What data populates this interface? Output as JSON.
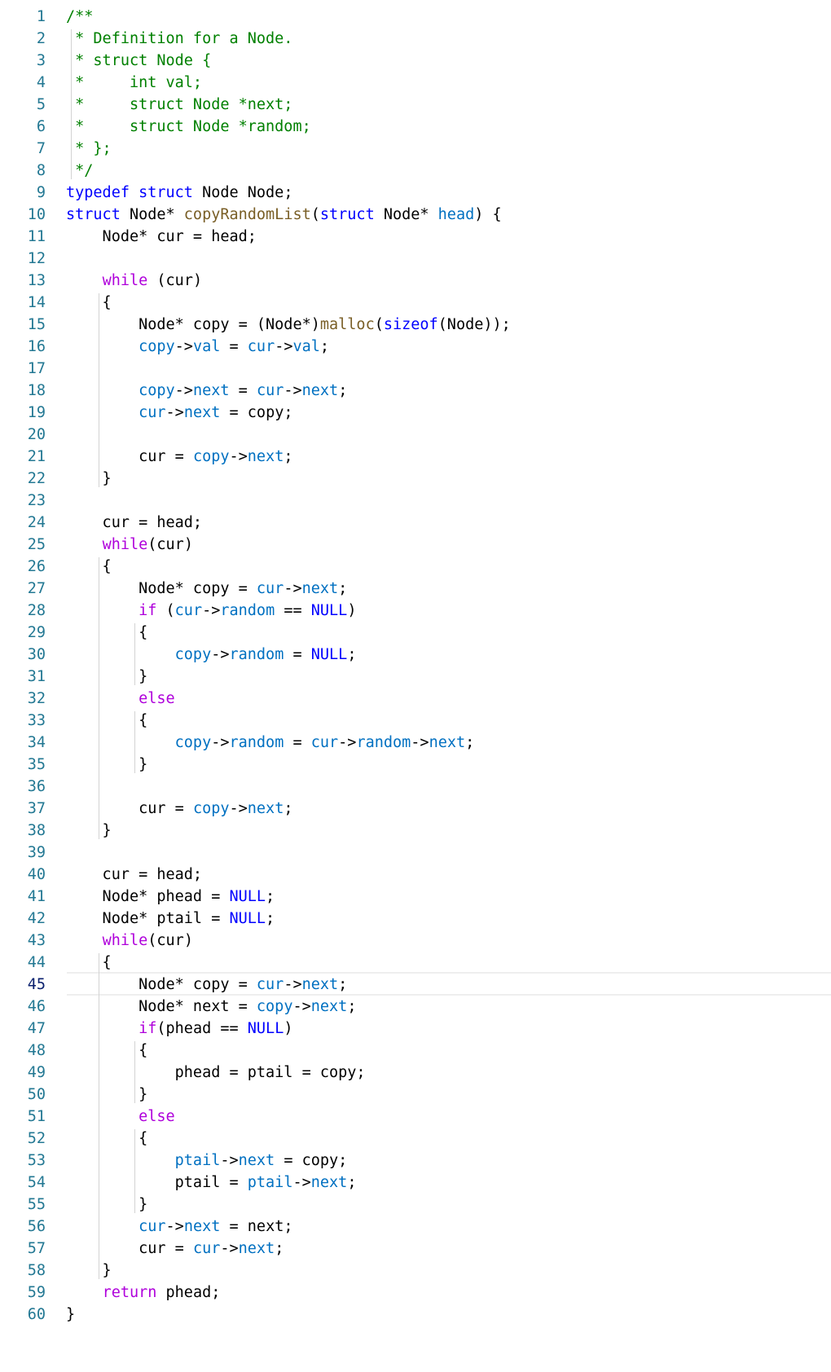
{
  "editor": {
    "language": "c",
    "active_line": 45,
    "colors": {
      "comment": "#008000",
      "keyword": "#0000ff",
      "function": "#795e26",
      "control": "#af00db",
      "member": "#0070c1",
      "default": "#000000",
      "line_number": "#237893"
    },
    "lines": [
      {
        "n": "1",
        "tokens": [
          [
            "c",
            "/**"
          ]
        ]
      },
      {
        "n": "2",
        "tokens": [
          [
            "c",
            " * Definition for a Node."
          ]
        ]
      },
      {
        "n": "3",
        "tokens": [
          [
            "c",
            " * struct Node {"
          ]
        ]
      },
      {
        "n": "4",
        "tokens": [
          [
            "c",
            " *     int val;"
          ]
        ]
      },
      {
        "n": "5",
        "tokens": [
          [
            "c",
            " *     struct Node *next;"
          ]
        ]
      },
      {
        "n": "6",
        "tokens": [
          [
            "c",
            " *     struct Node *random;"
          ]
        ]
      },
      {
        "n": "7",
        "tokens": [
          [
            "c",
            " * };"
          ]
        ]
      },
      {
        "n": "8",
        "tokens": [
          [
            "c",
            " */"
          ]
        ]
      },
      {
        "n": "9",
        "tokens": [
          [
            "k",
            "typedef"
          ],
          [
            "d",
            " "
          ],
          [
            "k",
            "struct"
          ],
          [
            "d",
            " Node Node;"
          ]
        ]
      },
      {
        "n": "10",
        "tokens": [
          [
            "k",
            "struct"
          ],
          [
            "d",
            " Node* "
          ],
          [
            "f",
            "copyRandomList"
          ],
          [
            "d",
            "("
          ],
          [
            "k",
            "struct"
          ],
          [
            "d",
            " Node* "
          ],
          [
            "v",
            "head"
          ],
          [
            "d",
            ") {"
          ]
        ]
      },
      {
        "n": "11",
        "tokens": [
          [
            "d",
            "    Node* cur = head;"
          ]
        ]
      },
      {
        "n": "12",
        "tokens": []
      },
      {
        "n": "13",
        "tokens": [
          [
            "d",
            "    "
          ],
          [
            "ctl",
            "while"
          ],
          [
            "d",
            " (cur)"
          ]
        ]
      },
      {
        "n": "14",
        "tokens": [
          [
            "d",
            "    {"
          ]
        ]
      },
      {
        "n": "15",
        "tokens": [
          [
            "d",
            "        Node* copy = (Node*)"
          ],
          [
            "f",
            "malloc"
          ],
          [
            "d",
            "("
          ],
          [
            "k",
            "sizeof"
          ],
          [
            "d",
            "(Node));"
          ]
        ]
      },
      {
        "n": "16",
        "tokens": [
          [
            "d",
            "        "
          ],
          [
            "v",
            "copy"
          ],
          [
            "d",
            "->"
          ],
          [
            "v",
            "val"
          ],
          [
            "d",
            " = "
          ],
          [
            "v",
            "cur"
          ],
          [
            "d",
            "->"
          ],
          [
            "v",
            "val"
          ],
          [
            "d",
            ";"
          ]
        ]
      },
      {
        "n": "17",
        "tokens": []
      },
      {
        "n": "18",
        "tokens": [
          [
            "d",
            "        "
          ],
          [
            "v",
            "copy"
          ],
          [
            "d",
            "->"
          ],
          [
            "v",
            "next"
          ],
          [
            "d",
            " = "
          ],
          [
            "v",
            "cur"
          ],
          [
            "d",
            "->"
          ],
          [
            "v",
            "next"
          ],
          [
            "d",
            ";"
          ]
        ]
      },
      {
        "n": "19",
        "tokens": [
          [
            "d",
            "        "
          ],
          [
            "v",
            "cur"
          ],
          [
            "d",
            "->"
          ],
          [
            "v",
            "next"
          ],
          [
            "d",
            " = copy;"
          ]
        ]
      },
      {
        "n": "20",
        "tokens": []
      },
      {
        "n": "21",
        "tokens": [
          [
            "d",
            "        cur = "
          ],
          [
            "v",
            "copy"
          ],
          [
            "d",
            "->"
          ],
          [
            "v",
            "next"
          ],
          [
            "d",
            ";"
          ]
        ]
      },
      {
        "n": "22",
        "tokens": [
          [
            "d",
            "    }"
          ]
        ]
      },
      {
        "n": "23",
        "tokens": []
      },
      {
        "n": "24",
        "tokens": [
          [
            "d",
            "    cur = head;"
          ]
        ]
      },
      {
        "n": "25",
        "tokens": [
          [
            "d",
            "    "
          ],
          [
            "ctl",
            "while"
          ],
          [
            "d",
            "(cur)"
          ]
        ]
      },
      {
        "n": "26",
        "tokens": [
          [
            "d",
            "    {"
          ]
        ]
      },
      {
        "n": "27",
        "tokens": [
          [
            "d",
            "        Node* copy = "
          ],
          [
            "v",
            "cur"
          ],
          [
            "d",
            "->"
          ],
          [
            "v",
            "next"
          ],
          [
            "d",
            ";"
          ]
        ]
      },
      {
        "n": "28",
        "tokens": [
          [
            "d",
            "        "
          ],
          [
            "ctl",
            "if"
          ],
          [
            "d",
            " ("
          ],
          [
            "v",
            "cur"
          ],
          [
            "d",
            "->"
          ],
          [
            "v",
            "random"
          ],
          [
            "d",
            " == "
          ],
          [
            "k",
            "NULL"
          ],
          [
            "d",
            ")"
          ]
        ]
      },
      {
        "n": "29",
        "tokens": [
          [
            "d",
            "        {"
          ]
        ]
      },
      {
        "n": "30",
        "tokens": [
          [
            "d",
            "            "
          ],
          [
            "v",
            "copy"
          ],
          [
            "d",
            "->"
          ],
          [
            "v",
            "random"
          ],
          [
            "d",
            " = "
          ],
          [
            "k",
            "NULL"
          ],
          [
            "d",
            ";"
          ]
        ]
      },
      {
        "n": "31",
        "tokens": [
          [
            "d",
            "        }"
          ]
        ]
      },
      {
        "n": "32",
        "tokens": [
          [
            "d",
            "        "
          ],
          [
            "ctl",
            "else"
          ]
        ]
      },
      {
        "n": "33",
        "tokens": [
          [
            "d",
            "        {"
          ]
        ]
      },
      {
        "n": "34",
        "tokens": [
          [
            "d",
            "            "
          ],
          [
            "v",
            "copy"
          ],
          [
            "d",
            "->"
          ],
          [
            "v",
            "random"
          ],
          [
            "d",
            " = "
          ],
          [
            "v",
            "cur"
          ],
          [
            "d",
            "->"
          ],
          [
            "v",
            "random"
          ],
          [
            "d",
            "->"
          ],
          [
            "v",
            "next"
          ],
          [
            "d",
            ";"
          ]
        ]
      },
      {
        "n": "35",
        "tokens": [
          [
            "d",
            "        }"
          ]
        ]
      },
      {
        "n": "36",
        "tokens": []
      },
      {
        "n": "37",
        "tokens": [
          [
            "d",
            "        cur = "
          ],
          [
            "v",
            "copy"
          ],
          [
            "d",
            "->"
          ],
          [
            "v",
            "next"
          ],
          [
            "d",
            ";"
          ]
        ]
      },
      {
        "n": "38",
        "tokens": [
          [
            "d",
            "    }"
          ]
        ]
      },
      {
        "n": "39",
        "tokens": []
      },
      {
        "n": "40",
        "tokens": [
          [
            "d",
            "    cur = head;"
          ]
        ]
      },
      {
        "n": "41",
        "tokens": [
          [
            "d",
            "    Node* phead = "
          ],
          [
            "k",
            "NULL"
          ],
          [
            "d",
            ";"
          ]
        ]
      },
      {
        "n": "42",
        "tokens": [
          [
            "d",
            "    Node* ptail = "
          ],
          [
            "k",
            "NULL"
          ],
          [
            "d",
            ";"
          ]
        ]
      },
      {
        "n": "43",
        "tokens": [
          [
            "d",
            "    "
          ],
          [
            "ctl",
            "while"
          ],
          [
            "d",
            "(cur)"
          ]
        ]
      },
      {
        "n": "44",
        "tokens": [
          [
            "d",
            "    {"
          ]
        ]
      },
      {
        "n": "45",
        "tokens": [
          [
            "d",
            "        Node* copy = "
          ],
          [
            "v",
            "cur"
          ],
          [
            "d",
            "->"
          ],
          [
            "v",
            "next"
          ],
          [
            "d",
            ";"
          ]
        ]
      },
      {
        "n": "46",
        "tokens": [
          [
            "d",
            "        Node* next = "
          ],
          [
            "v",
            "copy"
          ],
          [
            "d",
            "->"
          ],
          [
            "v",
            "next"
          ],
          [
            "d",
            ";"
          ]
        ]
      },
      {
        "n": "47",
        "tokens": [
          [
            "d",
            "        "
          ],
          [
            "ctl",
            "if"
          ],
          [
            "d",
            "(phead == "
          ],
          [
            "k",
            "NULL"
          ],
          [
            "d",
            ")"
          ]
        ]
      },
      {
        "n": "48",
        "tokens": [
          [
            "d",
            "        {"
          ]
        ]
      },
      {
        "n": "49",
        "tokens": [
          [
            "d",
            "            phead = ptail = copy;"
          ]
        ]
      },
      {
        "n": "50",
        "tokens": [
          [
            "d",
            "        }"
          ]
        ]
      },
      {
        "n": "51",
        "tokens": [
          [
            "d",
            "        "
          ],
          [
            "ctl",
            "else"
          ]
        ]
      },
      {
        "n": "52",
        "tokens": [
          [
            "d",
            "        {"
          ]
        ]
      },
      {
        "n": "53",
        "tokens": [
          [
            "d",
            "            "
          ],
          [
            "v",
            "ptail"
          ],
          [
            "d",
            "->"
          ],
          [
            "v",
            "next"
          ],
          [
            "d",
            " = copy;"
          ]
        ]
      },
      {
        "n": "54",
        "tokens": [
          [
            "d",
            "            ptail = "
          ],
          [
            "v",
            "ptail"
          ],
          [
            "d",
            "->"
          ],
          [
            "v",
            "next"
          ],
          [
            "d",
            ";"
          ]
        ]
      },
      {
        "n": "55",
        "tokens": [
          [
            "d",
            "        }"
          ]
        ]
      },
      {
        "n": "56",
        "tokens": [
          [
            "d",
            "        "
          ],
          [
            "v",
            "cur"
          ],
          [
            "d",
            "->"
          ],
          [
            "v",
            "next"
          ],
          [
            "d",
            " = next;"
          ]
        ]
      },
      {
        "n": "57",
        "tokens": [
          [
            "d",
            "        cur = "
          ],
          [
            "v",
            "cur"
          ],
          [
            "d",
            "->"
          ],
          [
            "v",
            "next"
          ],
          [
            "d",
            ";"
          ]
        ]
      },
      {
        "n": "58",
        "tokens": [
          [
            "d",
            "    }"
          ]
        ]
      },
      {
        "n": "59",
        "tokens": [
          [
            "d",
            "    "
          ],
          [
            "ctl",
            "return"
          ],
          [
            "d",
            " phead;"
          ]
        ]
      },
      {
        "n": "60",
        "tokens": [
          [
            "d",
            "}"
          ]
        ]
      }
    ]
  }
}
